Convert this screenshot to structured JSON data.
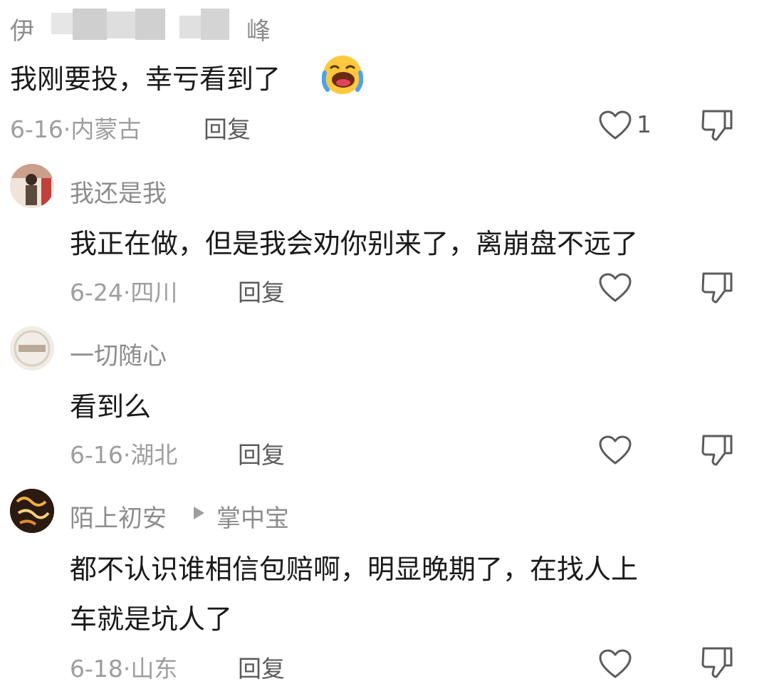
{
  "comments": [
    {
      "author_prefix": "伊",
      "author_suffix": "峰",
      "text": "我刚要投，幸亏看到了",
      "emoji": "laughing-crying-emoji",
      "date": "6-16·",
      "location": "内蒙古",
      "reply_label": "回复",
      "like_count": "1"
    },
    {
      "author": "我还是我",
      "text": "我正在做，但是我会劝你别来了，离崩盘不远了",
      "date": "6-24·",
      "location": "四川",
      "reply_label": "回复"
    },
    {
      "author": "一切随心",
      "text": "看到么",
      "date": "6-16·",
      "location": "湖北",
      "reply_label": "回复"
    },
    {
      "author": "陌上初安",
      "reply_to": "掌中宝",
      "text_line1": "都不认识谁相信包赔啊，明显晚期了，在找人上",
      "text_line2": "车就是坑人了",
      "date": "6-18·",
      "location": "山东",
      "reply_label": "回复"
    }
  ],
  "colors": {
    "text": "#1a1a1a",
    "meta": "#9e9e9e",
    "name": "#8d8d8d",
    "icon": "#5b5b5b"
  },
  "icons": [
    "heart-outline-icon",
    "dislike-icon",
    "reply-arrow-icon"
  ]
}
